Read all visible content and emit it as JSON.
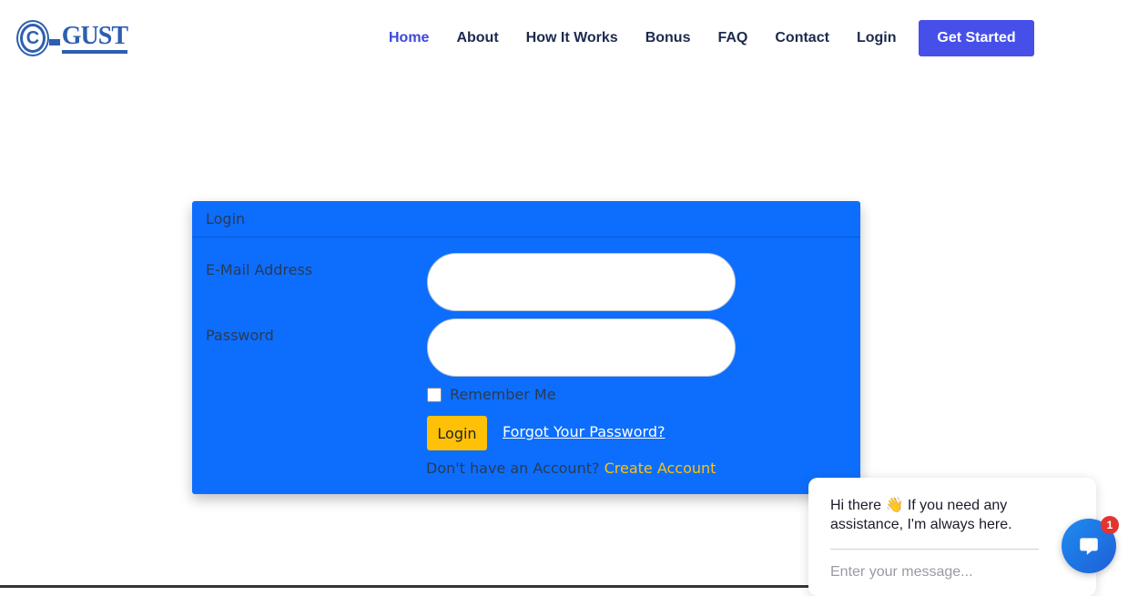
{
  "header": {
    "logo_text": "GUST",
    "logo_letter": "C",
    "nav": [
      {
        "label": "Home",
        "active": true
      },
      {
        "label": "About"
      },
      {
        "label": "How It Works"
      },
      {
        "label": "Bonus"
      },
      {
        "label": "FAQ"
      },
      {
        "label": "Contact"
      },
      {
        "label": "Login"
      }
    ],
    "cta_label": "Get Started"
  },
  "login_card": {
    "title": "Login",
    "email_label": "E-Mail Address",
    "email_value": "",
    "password_label": "Password",
    "password_value": "",
    "remember_label": "Remember Me",
    "remember_checked": false,
    "submit_label": "Login",
    "forgot_label": "Forgot Your Password?",
    "no_account_text": "Don't have an Account?",
    "create_account_label": "Create Account"
  },
  "chat": {
    "greeting": "Hi there 👋 If you need any assistance, I'm always here.",
    "input_placeholder": "Enter your message...",
    "unread_count": "1"
  },
  "colors": {
    "primary_blue": "#0d6efd",
    "cta": "#4650e8",
    "login_button": "#ffc107",
    "nav_active": "#3b49d8"
  }
}
